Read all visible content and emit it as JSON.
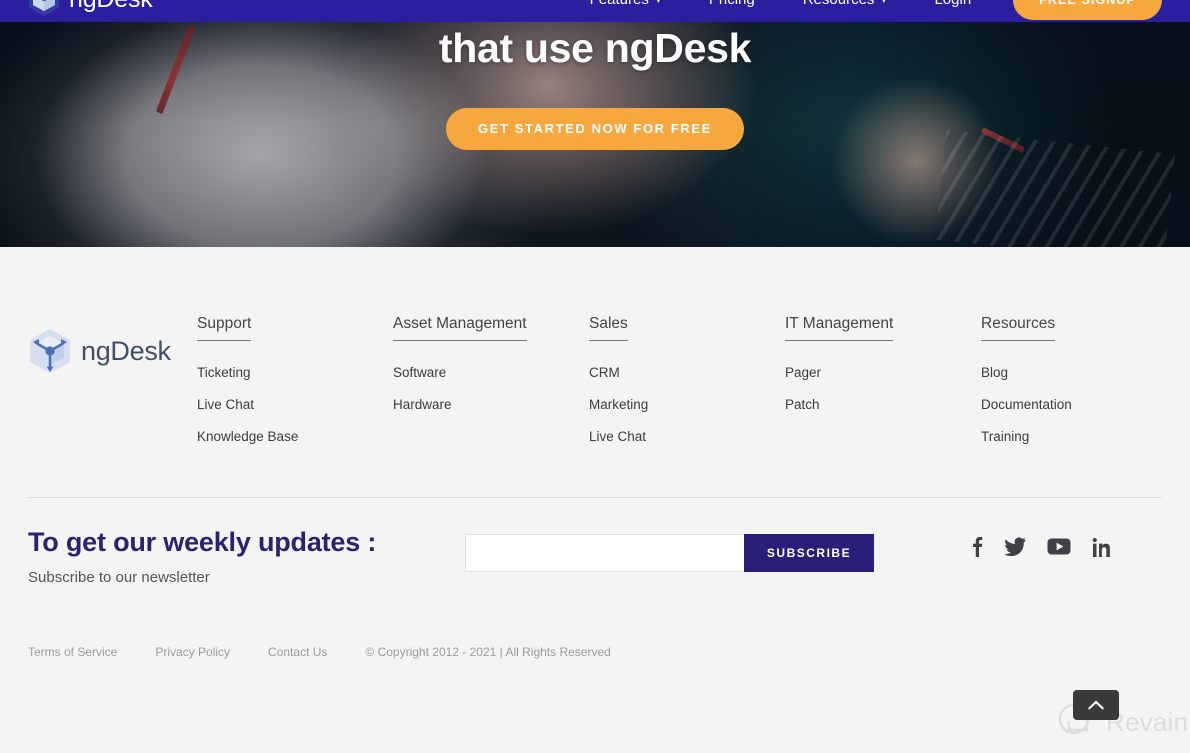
{
  "brand": {
    "name": "ngDesk",
    "nav_logo_icon": "cube-logo-icon",
    "footer_logo_icon": "cube-logo-icon",
    "accent_orange": "#f6a83e",
    "nav_purple": "#2a1f9e",
    "deep_purple": "#2a1f78",
    "footer_bg": "#f4f4f4"
  },
  "nav": {
    "items": [
      {
        "label": "Features",
        "has_caret": true,
        "caret": "▾"
      },
      {
        "label": "Pricing",
        "has_caret": false,
        "caret": ""
      },
      {
        "label": "Resources",
        "has_caret": true,
        "caret": "▾"
      },
      {
        "label": "Login",
        "has_caret": false,
        "caret": ""
      }
    ],
    "cta_label": "FREE SIGNUP"
  },
  "hero": {
    "title": "that use ngDesk",
    "cta_label": "GET STARTED NOW FOR FREE"
  },
  "footer": {
    "columns": [
      {
        "heading": "Support",
        "links": [
          "Ticketing",
          "Live Chat",
          "Knowledge Base"
        ]
      },
      {
        "heading": "Asset Management",
        "links": [
          "Software",
          "Hardware"
        ]
      },
      {
        "heading": "Sales",
        "links": [
          "CRM",
          "Marketing",
          "Live Chat"
        ]
      },
      {
        "heading": "IT Management",
        "links": [
          "Pager",
          "Patch"
        ]
      },
      {
        "heading": "Resources",
        "links": [
          "Blog",
          "Documentation",
          "Training"
        ]
      }
    ]
  },
  "newsletter": {
    "title": "To get our weekly updates :",
    "subtitle": "Subscribe to our newsletter",
    "input_value": "",
    "input_placeholder": "",
    "button_label": "SUBSCRIBE",
    "socials": [
      {
        "name": "facebook-icon"
      },
      {
        "name": "twitter-icon"
      },
      {
        "name": "youtube-icon"
      },
      {
        "name": "linkedin-icon"
      }
    ]
  },
  "bottom_bar": {
    "links": [
      "Terms of Service",
      "Privacy Policy",
      "Contact Us"
    ],
    "copyright": "© Copyright 2012 - 2021 | All Rights Reserved"
  },
  "scroll_top": {
    "icon": "chevron-up-icon"
  },
  "watermark": {
    "text": "Revain",
    "icon": "revain-logo-icon"
  }
}
